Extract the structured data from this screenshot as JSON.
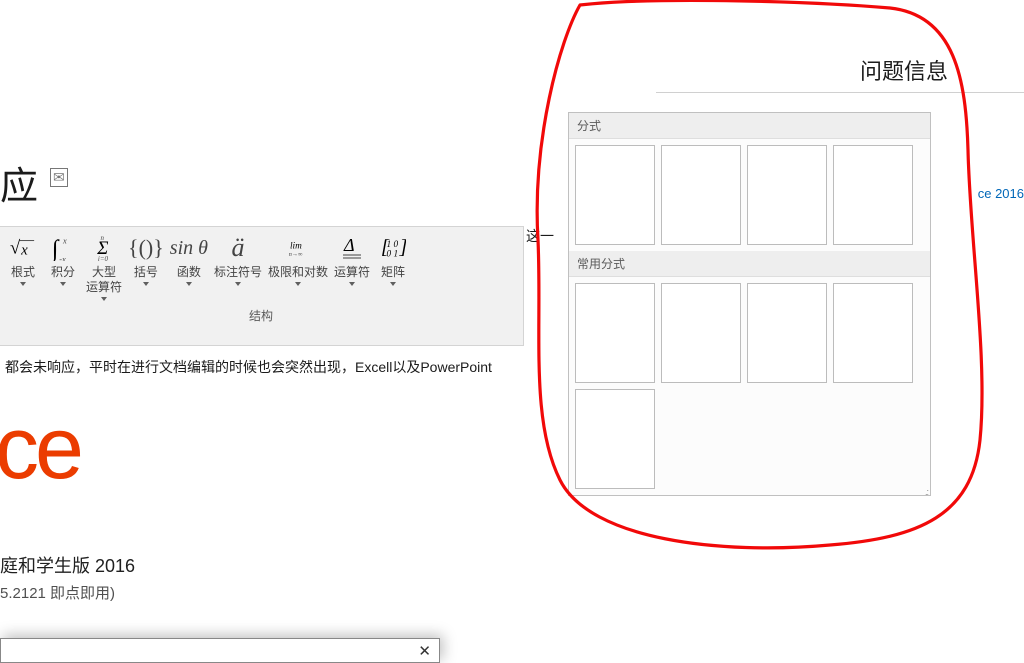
{
  "title_fragment": "应",
  "right_panel": {
    "title": "问题信息",
    "side_link": "ce 2016"
  },
  "gallery": {
    "section1_label": "分式",
    "section1_count": 4,
    "section2_label": "常用分式",
    "section2_count": 5
  },
  "ribbon": {
    "group_label": "结构",
    "items": [
      {
        "icon_html": "<svg viewBox='0 0 28 24'><text x='0' y='18' font-family=\"Cambria Math\" font-style='italic' font-size='20'>√</text><line x1='10' y1='4' x2='26' y2='4' stroke='#444' stroke-width='1'/><text x='12' y='19' font-family=\"Cambria Math\" font-style='italic' font-size='16'>x</text></svg>",
        "label": "根式"
      },
      {
        "icon_html": "<svg viewBox='0 0 28 26'><text x='2' y='22' font-family=\"Cambria Math\" font-style='italic' font-size='26'>∫</text><text x='14' y='8' font-size='9' fill='#444' font-style='italic'>x</text><text x='10' y='28' font-size='9' fill='#444' font-style='italic'>-x</text></svg>",
        "label": "积分"
      },
      {
        "icon_html": "<svg viewBox='0 0 30 30'><text x='7' y='22' font-family=\"Cambria Math\" font-size='22'>Σ</text><text x='11' y='6' font-size='8' fill='#444' font-style='italic'>n</text><text x='8' y='30' font-size='8' fill='#444' font-style='italic'>i=0</text></svg>",
        "label": "大型\n运算符"
      },
      {
        "icon_html": "<span style='font-style:normal;font-family:Cambria Math;font-size:22px'>{()}</span>",
        "label": "括号"
      },
      {
        "icon_html": "<span style='font-family:Cambria Math;font-size:20px'>sin θ</span>",
        "label": "函数"
      },
      {
        "icon_html": "<span style='font-family:Cambria Math;font-size:26px;font-style:italic'>ä</span>",
        "label": "标注符号"
      },
      {
        "icon_html": "<svg viewBox='0 0 42 26'><text x='8' y='14' font-family=\"Cambria Math\" font-size='15'>lim</text><text x='6' y='26' font-size='10' fill='#444' font-style='italic'>n→∞</text></svg>",
        "label": "极限和对数"
      },
      {
        "icon_html": "<svg viewBox='0 0 24 26'><text x='4' y='16' font-family=\"Cambria Math\" font-size='18'>Δ</text><line x1='3' y1='20' x2='21' y2='20' stroke='#444' stroke-width='1'/><line x1='3' y1='23' x2='21' y2='23' stroke='#444' stroke-width='1'/></svg>",
        "label": "运算符"
      },
      {
        "icon_html": "<svg viewBox='0 0 28 24'><text x='1' y='18' font-family=\"Cambria Math\" font-size='22'>[</text><text x='21' y='18' font-family=\"Cambria Math\" font-size='22'>]</text><text x='7' y='11' font-size='10'>1 0</text><text x='7' y='21' font-size='10'>0 1</text></svg>",
        "label": "矩阵"
      }
    ]
  },
  "body_text": {
    "fragment_right": "这一",
    "fragment_below": "都会未响应，平时在进行文档编辑的时候也会突然出现，Excell以及PowerPoint"
  },
  "product": {
    "logo_text": "ce",
    "edition": "庭和学生版 2016",
    "build": "5.2121 即点即用)"
  }
}
